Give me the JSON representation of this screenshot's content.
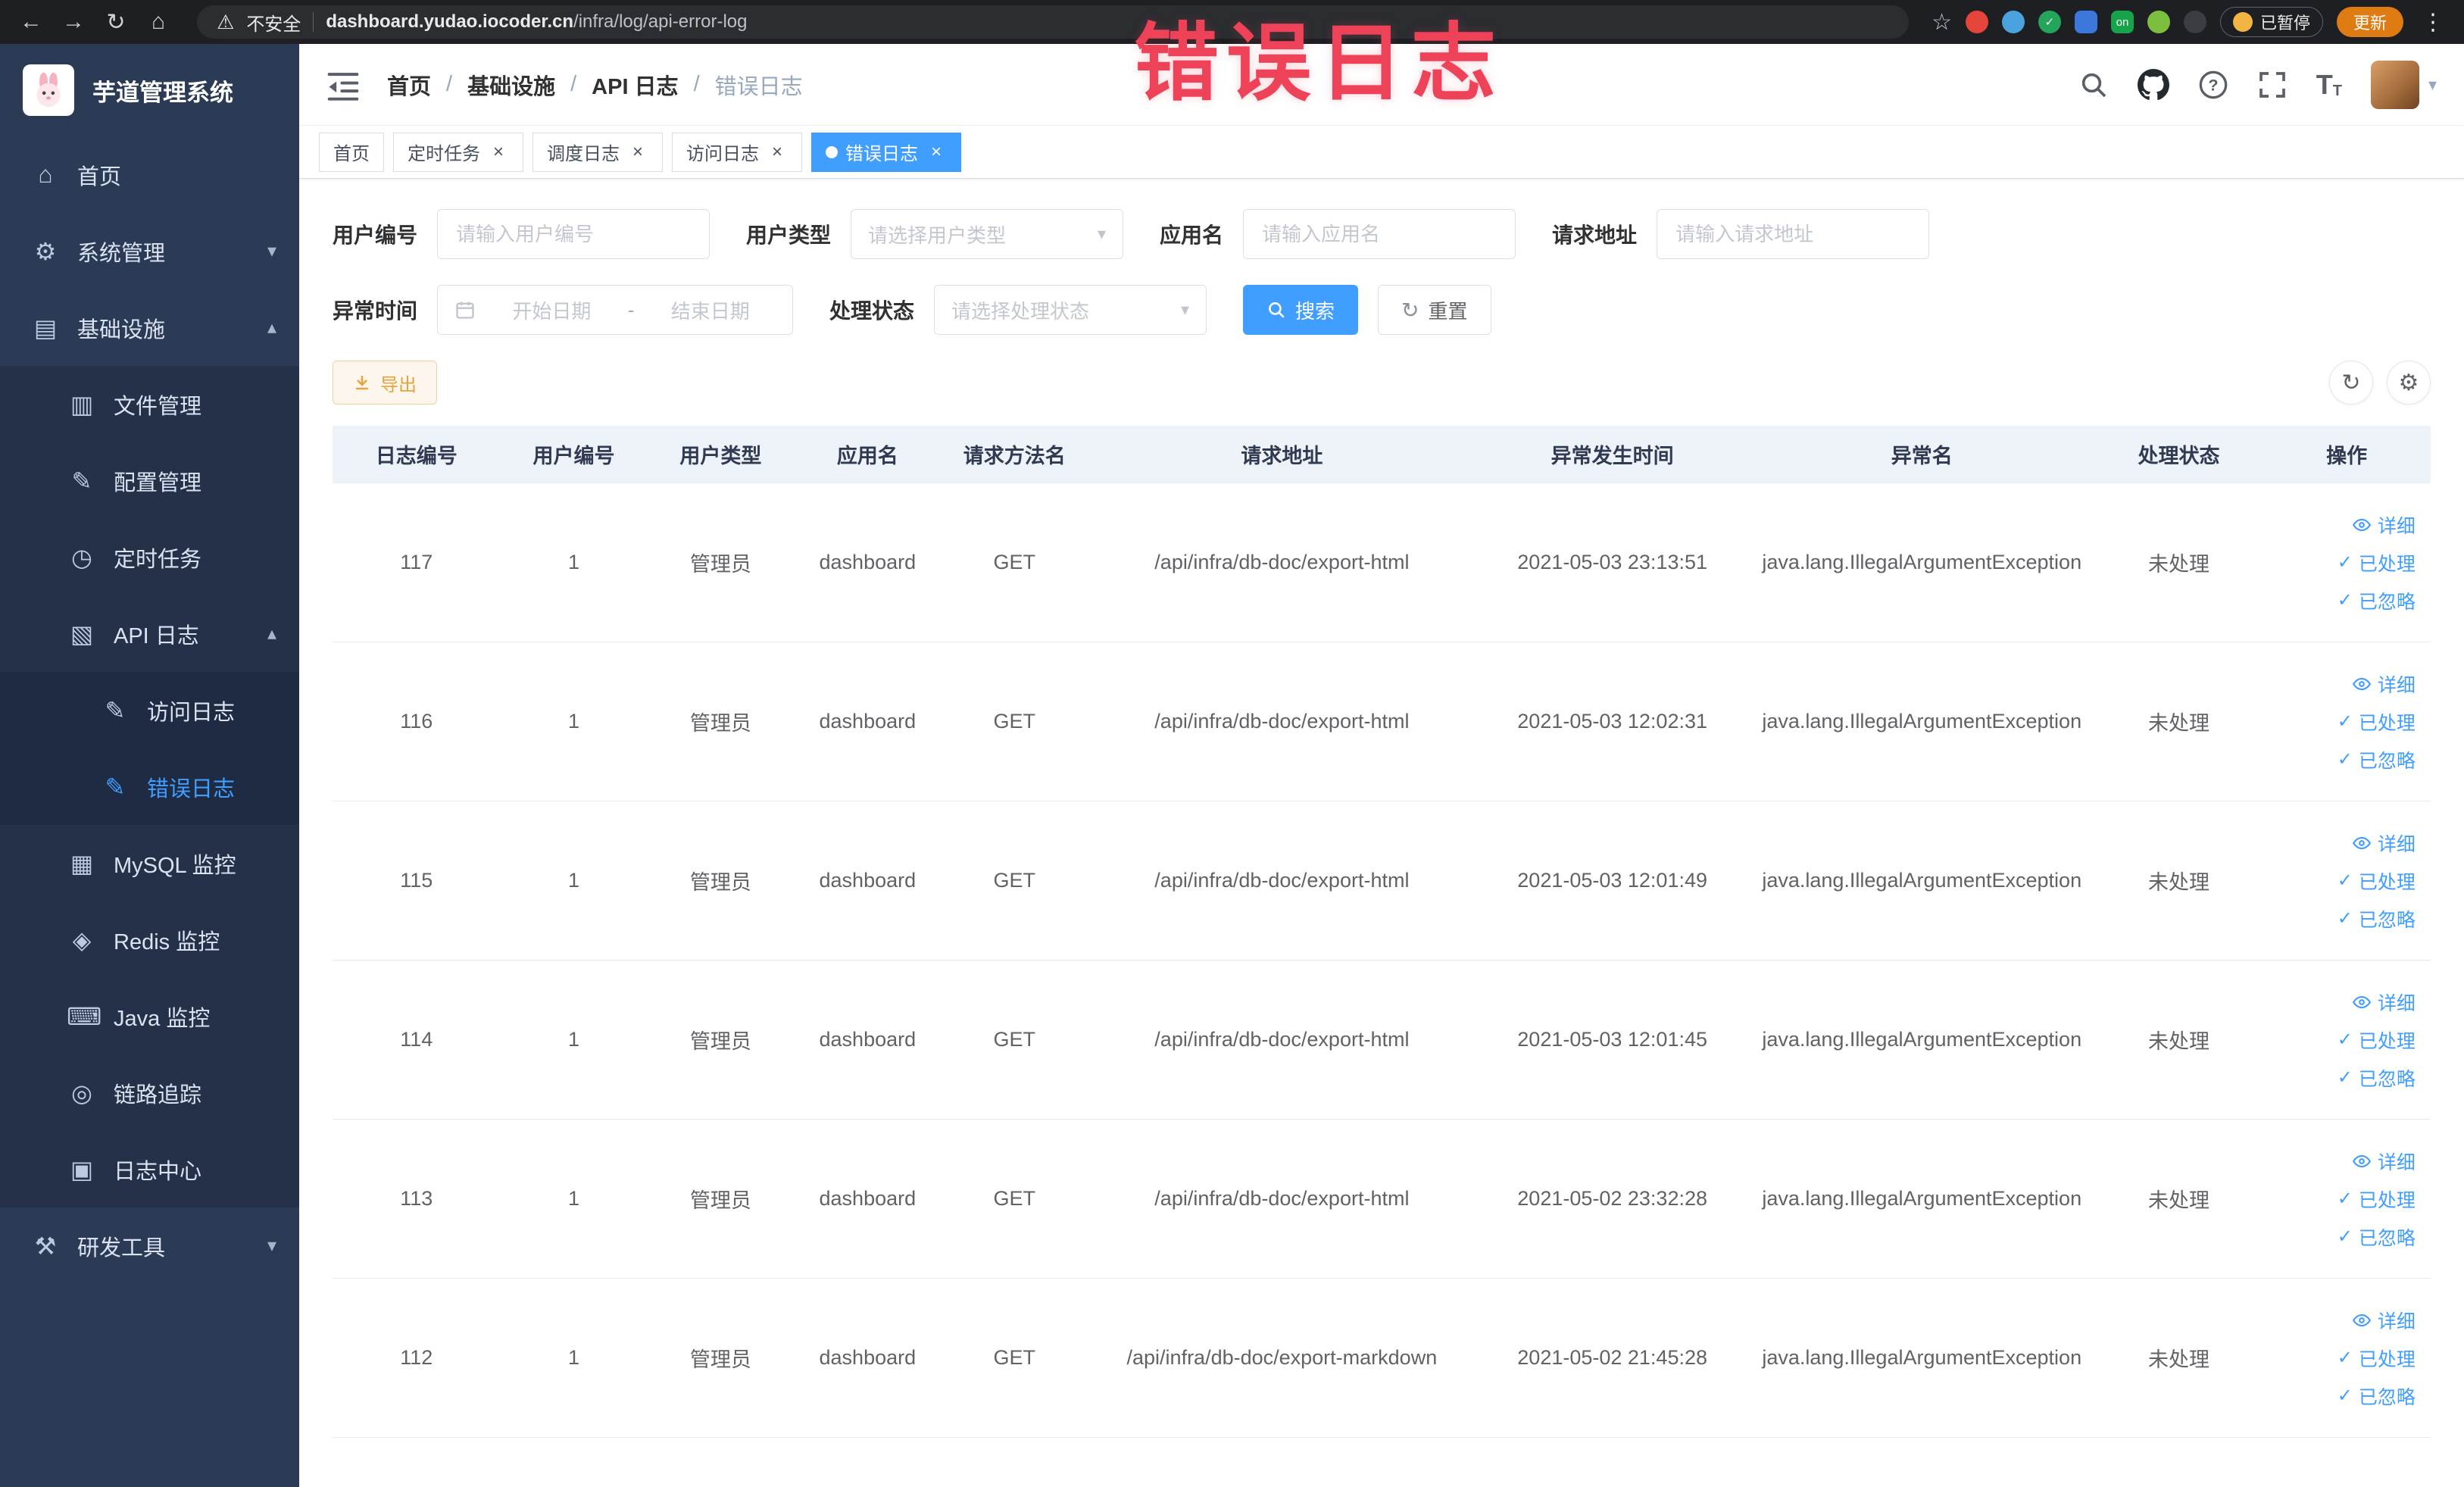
{
  "colors": {
    "primary": "#409EFF",
    "warning": "#E6A23C",
    "overlay_red": "#EE4258",
    "sidebar_bg": "#2B3A55",
    "table_header_bg": "#EEF2F9",
    "update_pill": "#DE7B12"
  },
  "icons": {
    "back": "←",
    "forward": "→",
    "reload": "↻",
    "home": "⌂",
    "warning": "⚠",
    "star": "☆",
    "kebab": "⋮",
    "close": "×",
    "caret_down": "▾",
    "caret_up": "▴",
    "breadcrumb_sep": "/",
    "check": "✓",
    "refresh": "↻",
    "gear": "⚙",
    "range_separator": "-"
  },
  "browser": {
    "security_label": "不安全",
    "url_host": "dashboard.yudao.iocoder.cn",
    "url_path": "/infra/log/api-error-log",
    "on_badge": "on",
    "paused_badge": "已暂停",
    "update_button": "更新"
  },
  "overlay_annotation": {
    "text": "错误日志"
  },
  "sidebar": {
    "title": "芋道管理系统",
    "items": [
      {
        "label": "首页",
        "icon": "⌂"
      },
      {
        "label": "系统管理",
        "icon": "⚙"
      },
      {
        "label": "基础设施",
        "icon": "▤"
      },
      {
        "label": "文件管理",
        "icon": "▥"
      },
      {
        "label": "配置管理",
        "icon": "✎"
      },
      {
        "label": "定时任务",
        "icon": "◷"
      },
      {
        "label": "API 日志",
        "icon": "▧"
      },
      {
        "label": "访问日志",
        "icon": "✎"
      },
      {
        "label": "错误日志",
        "icon": "✎"
      },
      {
        "label": "MySQL 监控",
        "icon": "▦"
      },
      {
        "label": "Redis 监控",
        "icon": "◈"
      },
      {
        "label": "Java 监控",
        "icon": "⌨"
      },
      {
        "label": "链路追踪",
        "icon": "◎"
      },
      {
        "label": "日志中心",
        "icon": "▣"
      },
      {
        "label": "研发工具",
        "icon": "⚒"
      }
    ]
  },
  "header": {
    "breadcrumb": [
      "首页",
      "基础设施",
      "API 日志",
      "错误日志"
    ]
  },
  "tags": [
    {
      "label": "首页"
    },
    {
      "label": "定时任务"
    },
    {
      "label": "调度日志"
    },
    {
      "label": "访问日志"
    },
    {
      "label": "错误日志"
    }
  ],
  "filters": {
    "user_id": {
      "label": "用户编号",
      "placeholder": "请输入用户编号"
    },
    "user_type": {
      "label": "用户类型",
      "placeholder": "请选择用户类型"
    },
    "app_name": {
      "label": "应用名",
      "placeholder": "请输入应用名"
    },
    "request_url": {
      "label": "请求地址",
      "placeholder": "请输入请求地址"
    },
    "exception_time": {
      "label": "异常时间",
      "start_placeholder": "开始日期",
      "end_placeholder": "结束日期"
    },
    "process_status": {
      "label": "处理状态",
      "placeholder": "请选择处理状态"
    },
    "search_button": "搜索",
    "reset_button": "重置"
  },
  "toolbar": {
    "export_button": "导出"
  },
  "table": {
    "columns": [
      "日志编号",
      "用户编号",
      "用户类型",
      "应用名",
      "请求方法名",
      "请求地址",
      "异常发生时间",
      "异常名",
      "处理状态",
      "操作"
    ],
    "action_labels": {
      "detail": "详细",
      "processed": "已处理",
      "ignored": "已忽略"
    },
    "rows": [
      {
        "id": "117",
        "user_id": "1",
        "user_type": "管理员",
        "app": "dashboard",
        "method": "GET",
        "url": "/api/infra/db-doc/export-html",
        "time": "2021-05-03 23:13:51",
        "exception": "java.lang.IllegalArgumentException",
        "status": "未处理"
      },
      {
        "id": "116",
        "user_id": "1",
        "user_type": "管理员",
        "app": "dashboard",
        "method": "GET",
        "url": "/api/infra/db-doc/export-html",
        "time": "2021-05-03 12:02:31",
        "exception": "java.lang.IllegalArgumentException",
        "status": "未处理"
      },
      {
        "id": "115",
        "user_id": "1",
        "user_type": "管理员",
        "app": "dashboard",
        "method": "GET",
        "url": "/api/infra/db-doc/export-html",
        "time": "2021-05-03 12:01:49",
        "exception": "java.lang.IllegalArgumentException",
        "status": "未处理"
      },
      {
        "id": "114",
        "user_id": "1",
        "user_type": "管理员",
        "app": "dashboard",
        "method": "GET",
        "url": "/api/infra/db-doc/export-html",
        "time": "2021-05-03 12:01:45",
        "exception": "java.lang.IllegalArgumentException",
        "status": "未处理"
      },
      {
        "id": "113",
        "user_id": "1",
        "user_type": "管理员",
        "app": "dashboard",
        "method": "GET",
        "url": "/api/infra/db-doc/export-html",
        "time": "2021-05-02 23:32:28",
        "exception": "java.lang.IllegalArgumentException",
        "status": "未处理"
      },
      {
        "id": "112",
        "user_id": "1",
        "user_type": "管理员",
        "app": "dashboard",
        "method": "GET",
        "url": "/api/infra/db-doc/export-markdown",
        "time": "2021-05-02 21:45:28",
        "exception": "java.lang.IllegalArgumentException",
        "status": "未处理"
      }
    ]
  }
}
